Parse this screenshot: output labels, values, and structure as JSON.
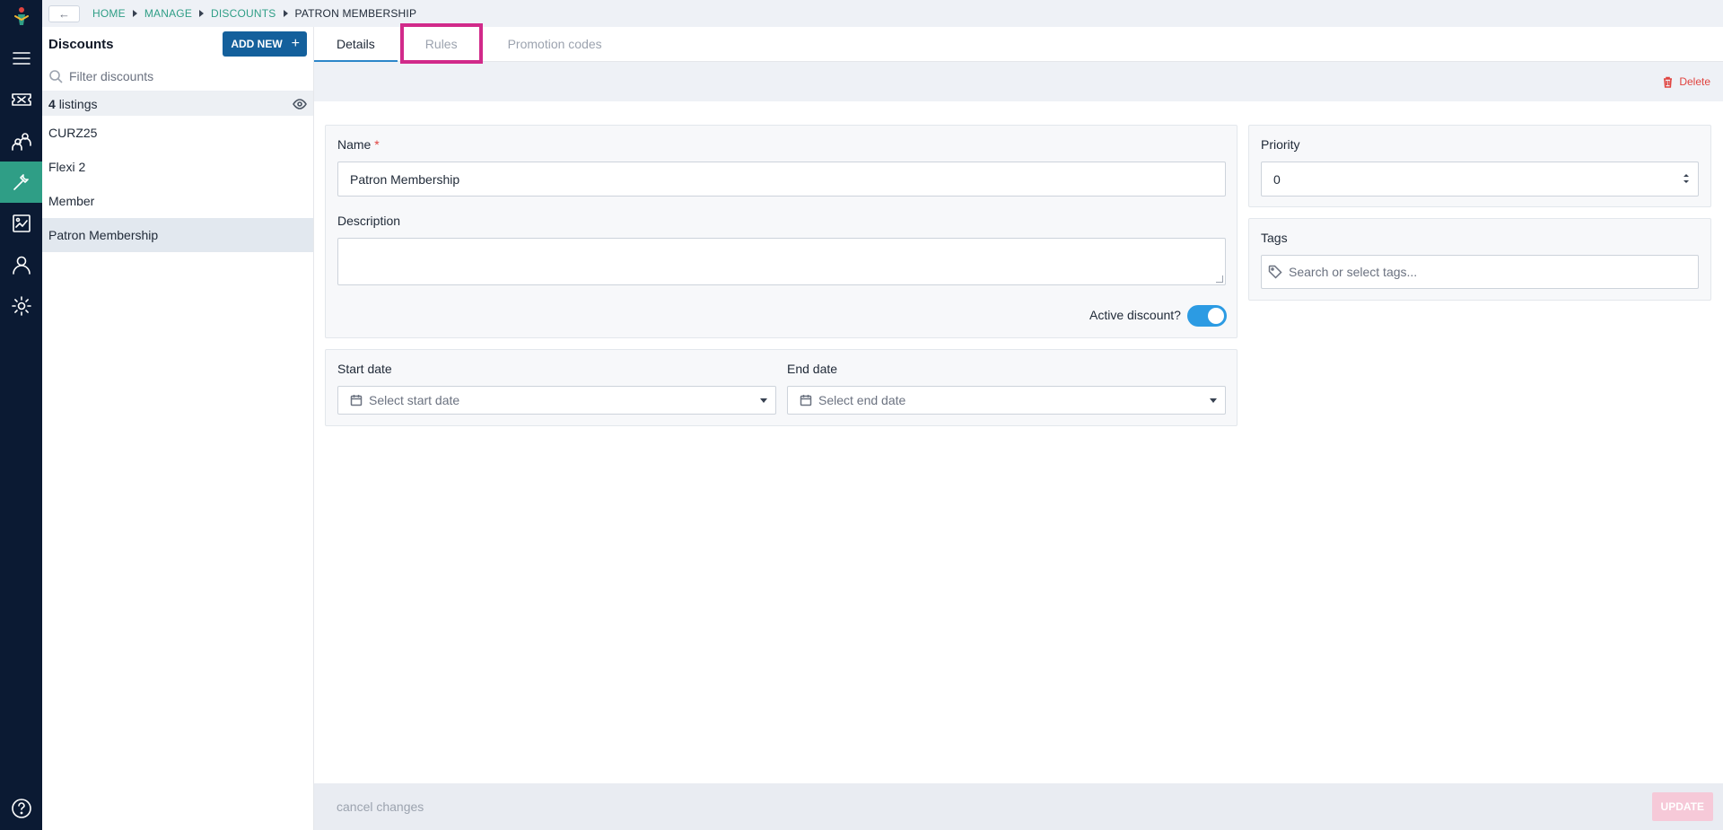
{
  "breadcrumb": {
    "back_label": "←",
    "items": [
      "HOME",
      "MANAGE",
      "DISCOUNTS",
      "PATRON MEMBERSHIP"
    ]
  },
  "rail": {
    "items": [
      "menu-icon",
      "ticket-icon",
      "people-icon",
      "tools-icon",
      "reports-icon",
      "user-icon",
      "settings-icon"
    ],
    "active": "tools-icon",
    "help": "help-icon"
  },
  "list": {
    "title": "Discounts",
    "add_label": "ADD NEW",
    "add_icon": "+",
    "filter_placeholder": "Filter discounts",
    "count_number": "4",
    "count_suffix": "listings",
    "items": [
      "CURZ25",
      "Flexi 2",
      "Member",
      "Patron Membership"
    ],
    "selected": "Patron Membership"
  },
  "tabs": [
    "Details",
    "Rules",
    "Promotion codes"
  ],
  "active_tab": "Details",
  "delete_label": "Delete",
  "form": {
    "name_label": "Name",
    "name_required": "*",
    "name_value": "Patron Membership",
    "description_label": "Description",
    "description_value": "",
    "active_label": "Active discount?",
    "active_on": true,
    "start_label": "Start date",
    "start_placeholder": "Select start date",
    "end_label": "End date",
    "end_placeholder": "Select end date",
    "priority_label": "Priority",
    "priority_value": "0",
    "tags_label": "Tags",
    "tags_placeholder": "Search or select tags..."
  },
  "footer": {
    "cancel_label": "cancel changes",
    "update_label": "UPDATE"
  },
  "colors": {
    "rail_bg": "#0b1a33",
    "rail_active": "#2f9e86",
    "accent_blue": "#14609c",
    "tab_underline": "#2c86c9",
    "highlight_box": "#d12a8a",
    "delete_red": "#e0433f",
    "toggle_on": "#2c9be3",
    "update_disabled": "#f6c9d8"
  }
}
